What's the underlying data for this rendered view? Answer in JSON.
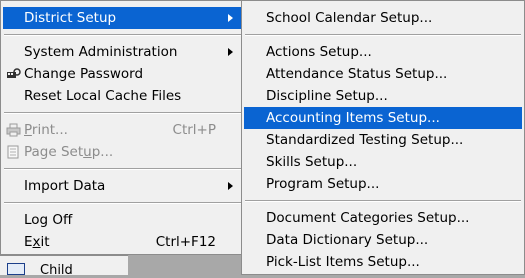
{
  "main_menu": {
    "district_setup": "District Setup",
    "system_administration": "System Administration",
    "change_password": "Change Password",
    "reset_cache": "Reset Local Cache Files",
    "print": {
      "label_u": "P",
      "label_rest": "rint...",
      "shortcut": "Ctrl+P"
    },
    "page_setup": {
      "label_pre": "Page Set",
      "label_u": "u",
      "label_rest": "p..."
    },
    "import_data": "Import Data",
    "log_off": "Log Off",
    "exit": {
      "label_pre": "E",
      "label_u": "x",
      "label_rest": "it",
      "shortcut": "Ctrl+F12"
    }
  },
  "sub_menu": {
    "items": [
      "School Calendar Setup...",
      "Actions Setup...",
      "Attendance Status Setup...",
      "Discipline Setup...",
      "Accounting Items Setup...",
      "Standardized Testing Setup...",
      "Skills Setup...",
      "Program Setup...",
      "Document Categories Setup...",
      "Data Dictionary Setup...",
      "Pick-List Items Setup..."
    ]
  },
  "taskbar": {
    "label": "Child"
  },
  "colors": {
    "highlight": "#0a64d2",
    "menu_bg": "#f0f0f0",
    "disabled": "#8c8c8c"
  }
}
